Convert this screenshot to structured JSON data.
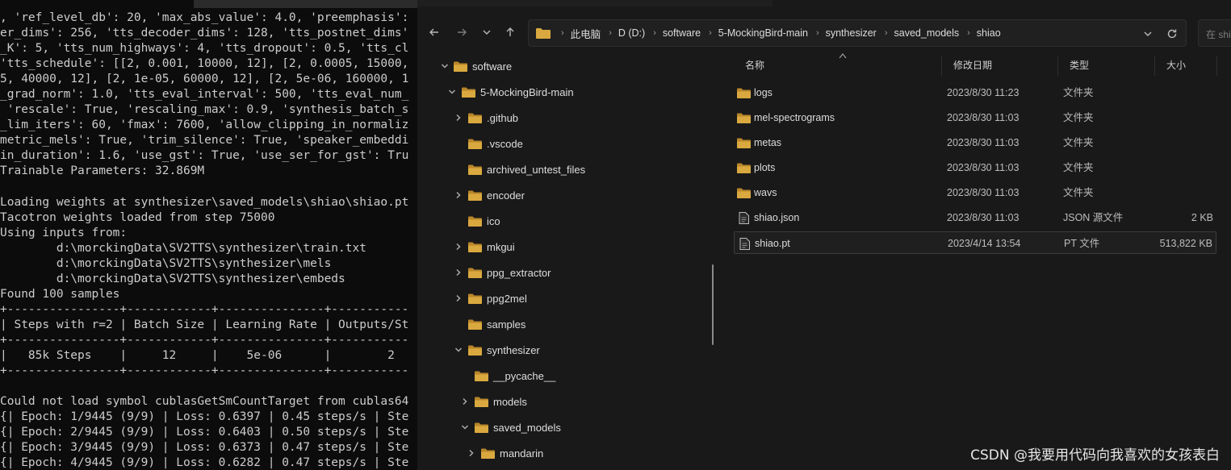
{
  "terminal": {
    "lines": [
      ", 'ref_level_db': 20, 'max_abs_value': 4.0, 'preemphasis':",
      "er_dims': 256, 'tts_decoder_dims': 128, 'tts_postnet_dims'",
      "_K': 5, 'tts_num_highways': 4, 'tts_dropout': 0.5, 'tts_cl",
      "'tts_schedule': [[2, 0.001, 10000, 12], [2, 0.0005, 15000,",
      "5, 40000, 12], [2, 1e-05, 60000, 12], [2, 5e-06, 160000, 1",
      "_grad_norm': 1.0, 'tts_eval_interval': 500, 'tts_eval_num_",
      " 'rescale': True, 'rescaling_max': 0.9, 'synthesis_batch_s",
      "_lim_iters': 60, 'fmax': 7600, 'allow_clipping_in_normaliz",
      "metric_mels': True, 'trim_silence': True, 'speaker_embeddi",
      "in_duration': 1.6, 'use_gst': True, 'use_ser_for_gst': Tru",
      "Trainable Parameters: 32.869M",
      "",
      "Loading weights at synthesizer\\saved_models\\shiao\\shiao.pt",
      "Tacotron weights loaded from step 75000",
      "Using inputs from:",
      "        d:\\morckingData\\SV2TTS\\synthesizer\\train.txt",
      "        d:\\morckingData\\SV2TTS\\synthesizer\\mels",
      "        d:\\morckingData\\SV2TTS\\synthesizer\\embeds",
      "Found 100 samples",
      "+----------------+------------+---------------+-----------",
      "| Steps with r=2 | Batch Size | Learning Rate | Outputs/St",
      "+----------------+------------+---------------+-----------",
      "|   85k Steps    |     12     |    5e-06      |        2",
      "+----------------+------------+---------------+-----------",
      "",
      "Could not load symbol cublasGetSmCountTarget from cublas64",
      "{| Epoch: 1/9445 (9/9) | Loss: 0.6397 | 0.45 steps/s | Ste",
      "{| Epoch: 2/9445 (9/9) | Loss: 0.6403 | 0.50 steps/s | Ste",
      "{| Epoch: 3/9445 (9/9) | Loss: 0.6373 | 0.47 steps/s | Ste",
      "{| Epoch: 4/9445 (9/9) | Loss: 0.6282 | 0.47 steps/s | Ste"
    ]
  },
  "explorer": {
    "breadcrumbs": [
      "此电脑",
      "D (D:)",
      "software",
      "5-MockingBird-main",
      "synthesizer",
      "saved_models",
      "shiao"
    ],
    "search_placeholder": "在 shiao",
    "tree": [
      {
        "label": "software",
        "expanded": true,
        "chevron": true
      },
      {
        "label": "5-MockingBird-main",
        "expanded": true,
        "chevron": true
      },
      {
        "label": ".github",
        "expanded": false,
        "chevron": true
      },
      {
        "label": ".vscode",
        "expanded": false,
        "chevron": false
      },
      {
        "label": "archived_untest_files",
        "expanded": false,
        "chevron": false
      },
      {
        "label": "encoder",
        "expanded": false,
        "chevron": true
      },
      {
        "label": "ico",
        "expanded": false,
        "chevron": false
      },
      {
        "label": "mkgui",
        "expanded": false,
        "chevron": true
      },
      {
        "label": "ppg_extractor",
        "expanded": false,
        "chevron": true
      },
      {
        "label": "ppg2mel",
        "expanded": false,
        "chevron": true
      },
      {
        "label": "samples",
        "expanded": false,
        "chevron": false
      },
      {
        "label": "synthesizer",
        "expanded": true,
        "chevron": true
      },
      {
        "label": "__pycache__",
        "expanded": false,
        "chevron": false
      },
      {
        "label": "models",
        "expanded": false,
        "chevron": true
      },
      {
        "label": "saved_models",
        "expanded": true,
        "chevron": true
      },
      {
        "label": "mandarin",
        "expanded": false,
        "chevron": true
      }
    ],
    "columns": {
      "name": "名称",
      "date": "修改日期",
      "type": "类型",
      "size": "大小"
    },
    "files": [
      {
        "name": "logs",
        "date": "2023/8/30 11:23",
        "type": "文件夹",
        "size": "",
        "kind": "folder"
      },
      {
        "name": "mel-spectrograms",
        "date": "2023/8/30 11:03",
        "type": "文件夹",
        "size": "",
        "kind": "folder"
      },
      {
        "name": "metas",
        "date": "2023/8/30 11:03",
        "type": "文件夹",
        "size": "",
        "kind": "folder"
      },
      {
        "name": "plots",
        "date": "2023/8/30 11:03",
        "type": "文件夹",
        "size": "",
        "kind": "folder"
      },
      {
        "name": "wavs",
        "date": "2023/8/30 11:03",
        "type": "文件夹",
        "size": "",
        "kind": "folder"
      },
      {
        "name": "shiao.json",
        "date": "2023/8/30 11:03",
        "type": "JSON 源文件",
        "size": "2 KB",
        "kind": "file"
      },
      {
        "name": "shiao.pt",
        "date": "2023/4/14 13:54",
        "type": "PT 文件",
        "size": "513,822 KB",
        "kind": "file"
      }
    ],
    "selected_file": "shiao.pt",
    "colors": {
      "folder": "#d9a93f",
      "folder_dark": "#b9862a",
      "accent": "#dcdcdc"
    }
  },
  "watermark": "CSDN @我要用代码向我喜欢的女孩表白"
}
